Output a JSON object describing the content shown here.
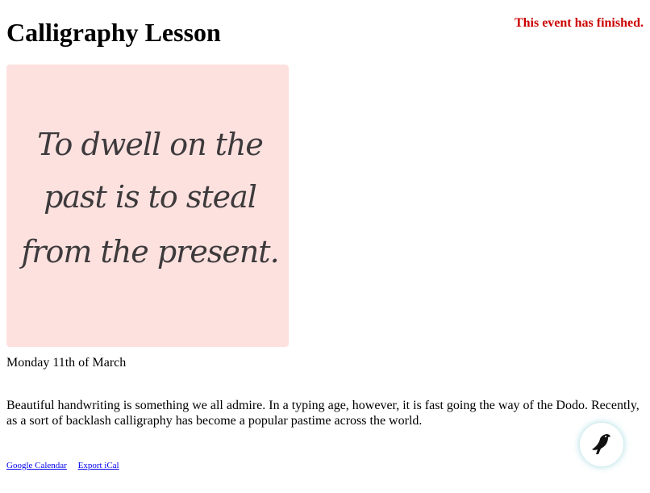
{
  "event": {
    "title": "Calligraphy Lesson",
    "status": "This event has finished.",
    "status_color": "#cc0000",
    "date": "Monday 11th of March",
    "description": "Beautiful handwriting is something we all admire. In a typing age, however, it is fast going the way of the Dodo. Recently, as a sort of backlash calligraphy has become a popular pastime across the world.",
    "image": {
      "background_color": "#fde1df",
      "lines": [
        "To dwell on the",
        "past is to steal",
        "from the present."
      ]
    }
  },
  "links": {
    "google_calendar": "Google Calendar",
    "export_ical": "Export iCal"
  },
  "widget": {
    "icon": "bird-icon"
  }
}
